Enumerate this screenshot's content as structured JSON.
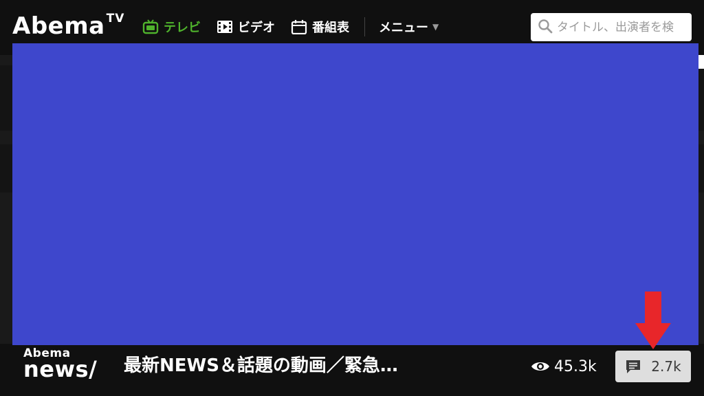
{
  "header": {
    "logo_text": "Abema",
    "logo_superscript": "TV",
    "nav": [
      {
        "label": "テレビ",
        "icon": "tv-icon",
        "active": true
      },
      {
        "label": "ビデオ",
        "icon": "film-icon",
        "active": false
      },
      {
        "label": "番組表",
        "icon": "calendar-icon",
        "active": false
      },
      {
        "label": "メニュー",
        "icon": "chevron-down-icon",
        "active": false
      }
    ],
    "search_placeholder": "タイトル、出演者を検"
  },
  "player": {
    "background": "#3e47cc"
  },
  "footer": {
    "channel_logo_top": "Abema",
    "channel_logo_bottom": "news/",
    "title": "最新NEWS＆話題の動画／緊急…",
    "views": "45.3k",
    "comments": "2.7k"
  },
  "colors": {
    "accent": "#4fb32c",
    "arrow": "#e8262a",
    "player": "#3e47cc"
  }
}
